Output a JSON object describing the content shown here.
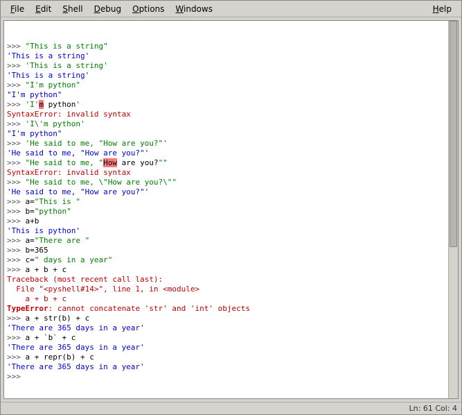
{
  "menubar": {
    "file": "File",
    "edit": "Edit",
    "shell": "Shell",
    "debug": "Debug",
    "options": "Options",
    "windows": "Windows",
    "help": "Help"
  },
  "shell": {
    "prompt": ">>> ",
    "lines": [
      {
        "type": "in",
        "segs": [
          {
            "c": "prompt",
            "t": ">>> "
          },
          {
            "c": "str",
            "t": "\"This is a string\""
          }
        ]
      },
      {
        "type": "out",
        "segs": [
          {
            "c": "out",
            "t": "'This is a string'"
          }
        ]
      },
      {
        "type": "in",
        "segs": [
          {
            "c": "prompt",
            "t": ">>> "
          },
          {
            "c": "str",
            "t": "'This is a string'"
          }
        ]
      },
      {
        "type": "out",
        "segs": [
          {
            "c": "out",
            "t": "'This is a string'"
          }
        ]
      },
      {
        "type": "in",
        "segs": [
          {
            "c": "prompt",
            "t": ">>> "
          },
          {
            "c": "str",
            "t": "\"I'm python\""
          }
        ]
      },
      {
        "type": "out",
        "segs": [
          {
            "c": "out",
            "t": "\"I'm python\""
          }
        ]
      },
      {
        "type": "in",
        "segs": [
          {
            "c": "prompt",
            "t": ">>> "
          },
          {
            "c": "str",
            "t": "'I'"
          },
          {
            "c": "hilite",
            "t": "m"
          },
          {
            "c": "blk",
            "t": " python"
          },
          {
            "c": "str",
            "t": "'"
          }
        ]
      },
      {
        "type": "err",
        "segs": [
          {
            "c": "err",
            "t": "SyntaxError: invalid syntax"
          }
        ]
      },
      {
        "type": "in",
        "segs": [
          {
            "c": "prompt",
            "t": ">>> "
          },
          {
            "c": "str",
            "t": "'I\\'m python'"
          }
        ]
      },
      {
        "type": "out",
        "segs": [
          {
            "c": "out",
            "t": "\"I'm python\""
          }
        ]
      },
      {
        "type": "in",
        "segs": [
          {
            "c": "prompt",
            "t": ">>> "
          },
          {
            "c": "str",
            "t": "'He said to me, \"How are you?\"'"
          }
        ]
      },
      {
        "type": "out",
        "segs": [
          {
            "c": "out",
            "t": "'He said to me, \"How are you?\"'"
          }
        ]
      },
      {
        "type": "in",
        "segs": [
          {
            "c": "prompt",
            "t": ">>> "
          },
          {
            "c": "str",
            "t": "\"He said to me, \""
          },
          {
            "c": "hilite",
            "t": "How"
          },
          {
            "c": "blk",
            "t": " are you?"
          },
          {
            "c": "str",
            "t": "\"\""
          }
        ]
      },
      {
        "type": "err",
        "segs": [
          {
            "c": "err",
            "t": "SyntaxError: invalid syntax"
          }
        ]
      },
      {
        "type": "in",
        "segs": [
          {
            "c": "prompt",
            "t": ">>> "
          },
          {
            "c": "str",
            "t": "\"He said to me, \\\"How are you?\\\"\""
          }
        ]
      },
      {
        "type": "out",
        "segs": [
          {
            "c": "out",
            "t": "'He said to me, \"How are you?\"'"
          }
        ]
      },
      {
        "type": "in",
        "segs": [
          {
            "c": "prompt",
            "t": ">>> "
          },
          {
            "c": "blk",
            "t": "a="
          },
          {
            "c": "str",
            "t": "\"This is \""
          }
        ]
      },
      {
        "type": "in",
        "segs": [
          {
            "c": "prompt",
            "t": ">>> "
          },
          {
            "c": "blk",
            "t": "b="
          },
          {
            "c": "str",
            "t": "\"python\""
          }
        ]
      },
      {
        "type": "in",
        "segs": [
          {
            "c": "prompt",
            "t": ">>> "
          },
          {
            "c": "blk",
            "t": "a+b"
          }
        ]
      },
      {
        "type": "out",
        "segs": [
          {
            "c": "out",
            "t": "'This is python'"
          }
        ]
      },
      {
        "type": "in",
        "segs": [
          {
            "c": "prompt",
            "t": ">>> "
          },
          {
            "c": "blk",
            "t": "a="
          },
          {
            "c": "str",
            "t": "\"There are \""
          }
        ]
      },
      {
        "type": "in",
        "segs": [
          {
            "c": "prompt",
            "t": ">>> "
          },
          {
            "c": "blk",
            "t": "b=365"
          }
        ]
      },
      {
        "type": "in",
        "segs": [
          {
            "c": "prompt",
            "t": ">>> "
          },
          {
            "c": "blk",
            "t": "c="
          },
          {
            "c": "str",
            "t": "\" days in a year\""
          }
        ]
      },
      {
        "type": "in",
        "segs": [
          {
            "c": "prompt",
            "t": ">>> "
          },
          {
            "c": "blk",
            "t": "a + b + c"
          }
        ]
      },
      {
        "type": "blank",
        "segs": [
          {
            "c": "blk",
            "t": ""
          }
        ]
      },
      {
        "type": "err",
        "segs": [
          {
            "c": "err",
            "t": "Traceback (most recent call last):"
          }
        ]
      },
      {
        "type": "err",
        "segs": [
          {
            "c": "err",
            "t": "  File \"<pyshell#14>\", line 1, in <module>"
          }
        ]
      },
      {
        "type": "err",
        "segs": [
          {
            "c": "err",
            "t": "    a + b + c"
          }
        ]
      },
      {
        "type": "err",
        "segs": [
          {
            "c": "errb",
            "t": "TypeError"
          },
          {
            "c": "err",
            "t": ": cannot concatenate 'str' and 'int' objects"
          }
        ]
      },
      {
        "type": "in",
        "segs": [
          {
            "c": "prompt",
            "t": ">>> "
          },
          {
            "c": "blk",
            "t": "a + str(b) + c"
          }
        ]
      },
      {
        "type": "out",
        "segs": [
          {
            "c": "out",
            "t": "'There are 365 days in a year'"
          }
        ]
      },
      {
        "type": "in",
        "segs": [
          {
            "c": "prompt",
            "t": ">>> "
          },
          {
            "c": "blk",
            "t": "a + `b` + c"
          }
        ]
      },
      {
        "type": "out",
        "segs": [
          {
            "c": "out",
            "t": "'There are 365 days in a year'"
          }
        ]
      },
      {
        "type": "in",
        "segs": [
          {
            "c": "prompt",
            "t": ">>> "
          },
          {
            "c": "blk",
            "t": "a + repr(b) + c"
          }
        ]
      },
      {
        "type": "out",
        "segs": [
          {
            "c": "out",
            "t": "'There are 365 days in a year'"
          }
        ]
      },
      {
        "type": "in",
        "segs": [
          {
            "c": "prompt",
            "t": ">>> "
          }
        ]
      }
    ]
  },
  "statusbar": {
    "position": "Ln: 61 Col: 4"
  }
}
